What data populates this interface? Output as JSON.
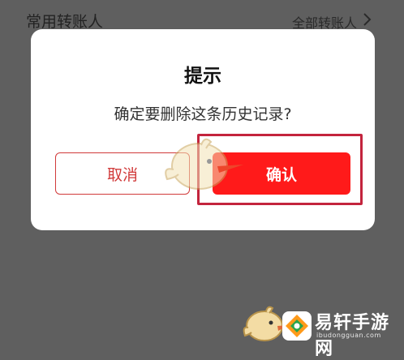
{
  "background": {
    "section_title": "常用转账人",
    "all_link": "全部转账人"
  },
  "dialog": {
    "title": "提示",
    "message": "确定要删除这条历史记录?",
    "cancel_label": "取消",
    "confirm_label": "确认"
  },
  "watermark": {
    "brand": "易轩手游网",
    "domain": "ibudongguan.com"
  },
  "colors": {
    "accent": "#ff1a1a",
    "cancel_border": "#d13a3a",
    "highlight": "#c3243d",
    "overlay": "#5f5f5f"
  }
}
